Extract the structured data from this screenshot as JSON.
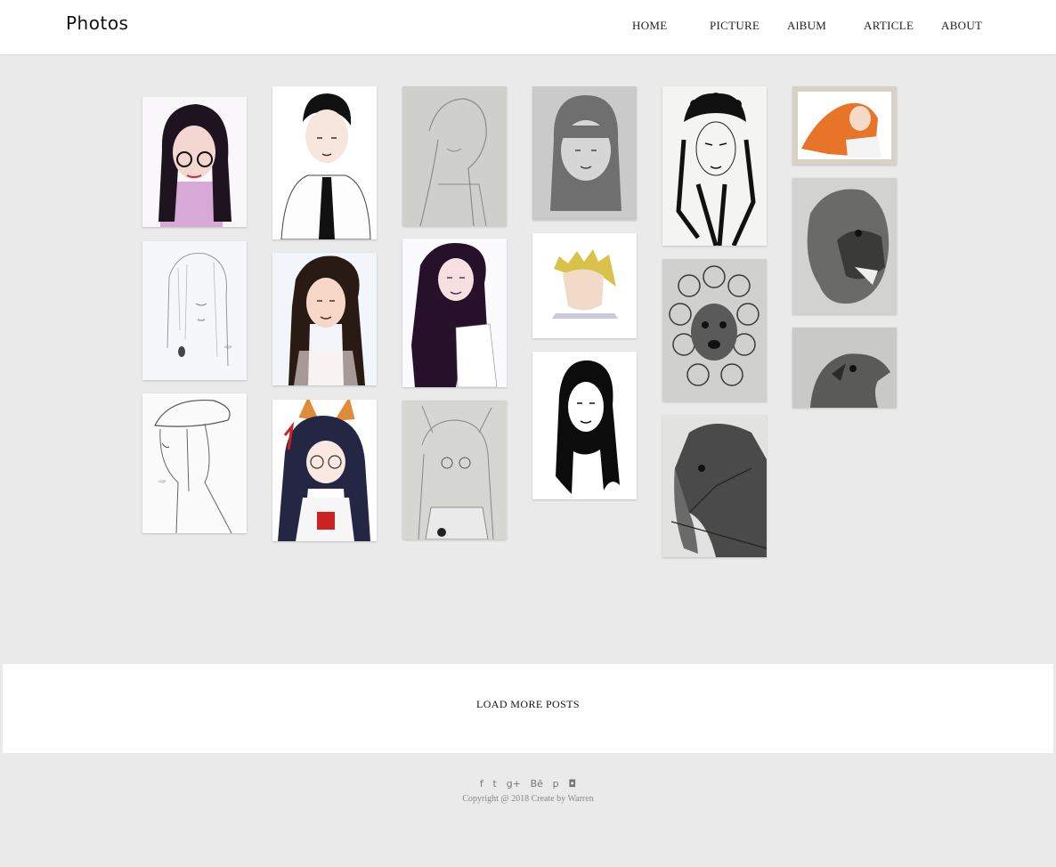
{
  "header": {
    "logo": "Photos",
    "nav": [
      {
        "label": "HOME"
      },
      {
        "label": "PICTURE"
      },
      {
        "label": "AlBUM"
      },
      {
        "label": "ARTICLE"
      },
      {
        "label": "ABOUT"
      }
    ]
  },
  "gallery": {
    "items": [
      {
        "subject": "girl-with-glasses-color-portrait"
      },
      {
        "subject": "pencil-sketch-girl"
      },
      {
        "subject": "girl-with-cap-line-sketch"
      },
      {
        "subject": "boy-with-tie-portrait"
      },
      {
        "subject": "long-hair-girl-color-portrait"
      },
      {
        "subject": "anime-girl-cat-ears"
      },
      {
        "subject": "anime-girl-pencil-sketch"
      },
      {
        "subject": "long-hair-girl-color-sketch"
      },
      {
        "subject": "fox-ear-girl-pencil-sketch"
      },
      {
        "subject": "girl-bob-pencil-portrait"
      },
      {
        "subject": "anime-yellow-hair"
      },
      {
        "subject": "black-ink-girl-portrait"
      },
      {
        "subject": "opera-mask-ink-drawing"
      },
      {
        "subject": "poodle-pencil-drawing"
      },
      {
        "subject": "horse-pencil-drawing"
      },
      {
        "subject": "orange-hair-anime-girl"
      },
      {
        "subject": "lion-pencil-drawing"
      },
      {
        "subject": "eagle-pencil-drawing"
      }
    ]
  },
  "load_more": {
    "label": "LOAD MORE POSTS"
  },
  "footer": {
    "social": [
      {
        "icon": "facebook-icon",
        "glyph": "f"
      },
      {
        "icon": "twitter-icon",
        "glyph": "t"
      },
      {
        "icon": "google-plus-icon",
        "glyph": "g+"
      },
      {
        "icon": "behance-icon",
        "glyph": "Bē"
      },
      {
        "icon": "pinterest-icon",
        "glyph": "p"
      },
      {
        "icon": "instagram-icon",
        "glyph": "◘"
      }
    ],
    "copyright": "Copyright @ 2018 Create by Warren"
  }
}
